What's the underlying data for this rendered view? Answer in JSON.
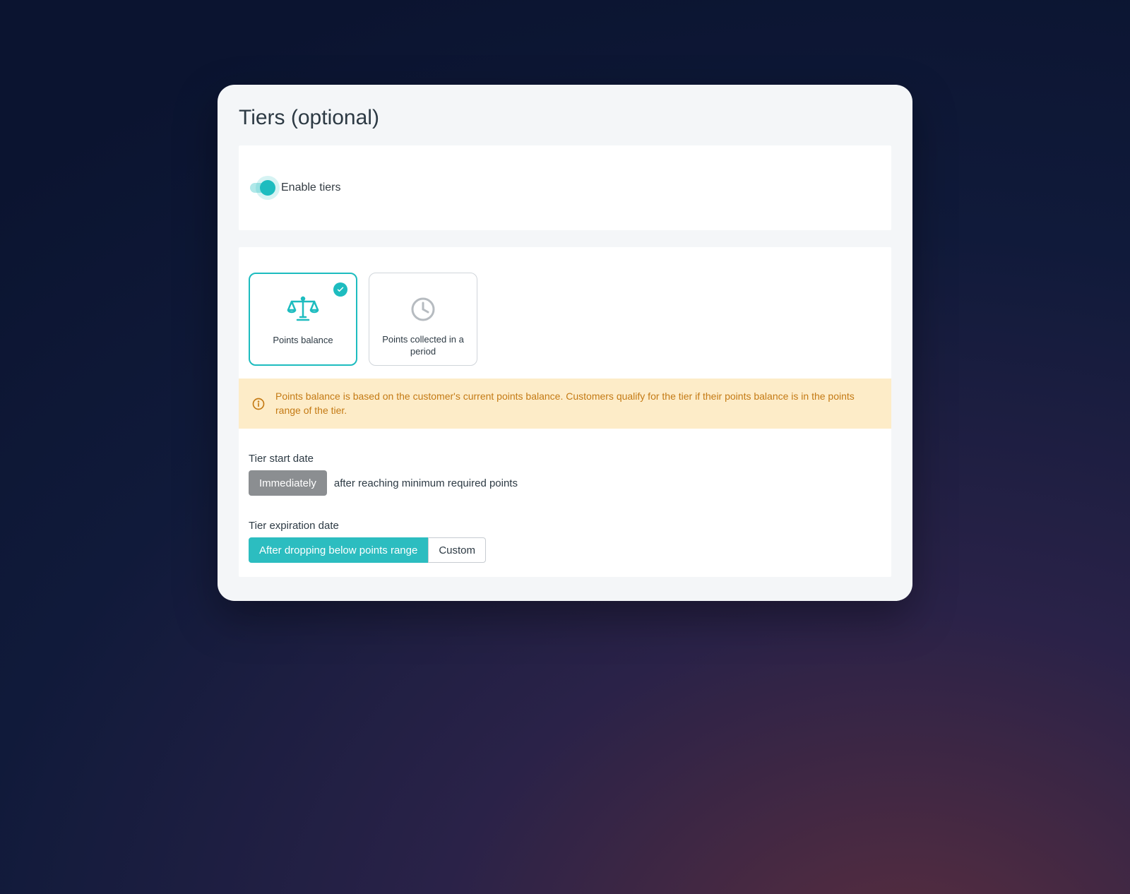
{
  "title": "Tiers (optional)",
  "toggle": {
    "label": "Enable tiers",
    "on": true
  },
  "options": [
    {
      "key": "balance",
      "label": "Points balance",
      "selected": true
    },
    {
      "key": "period",
      "label": "Points collected in a period",
      "selected": false
    }
  ],
  "info": "Points balance is based on the customer's current points balance. Customers qualify for the tier if their points balance is in the points range of the tier.",
  "start": {
    "label": "Tier start date",
    "chip": "Immediately",
    "suffix": "after reaching minimum required points"
  },
  "expire": {
    "label": "Tier expiration date",
    "option_a": "After dropping below points range",
    "option_b": "Custom"
  },
  "colors": {
    "accent": "#1dbcbf",
    "warn_bg": "#fdecc8",
    "warn_text": "#c47a14"
  }
}
